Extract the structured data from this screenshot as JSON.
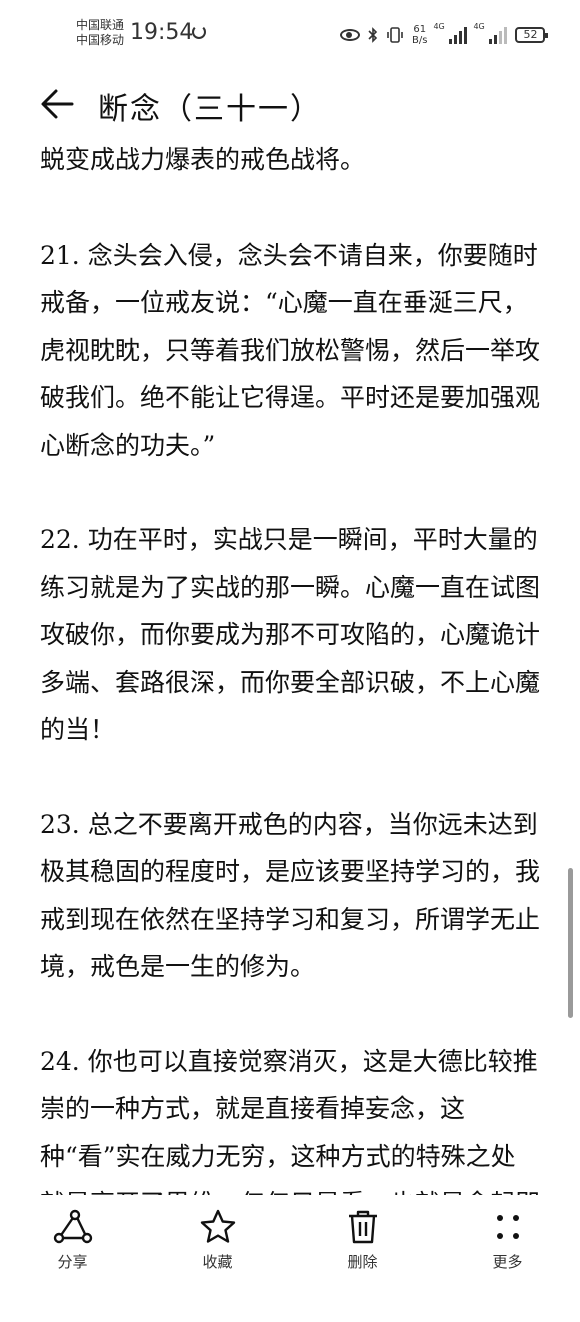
{
  "status_bar": {
    "carrier1": "中国联通",
    "carrier2": "中国移动",
    "time": "19:54",
    "net_speed_value": "61",
    "net_speed_unit": "B/s",
    "network1": "4G",
    "network2": "4G",
    "battery": "52"
  },
  "header": {
    "title": "断念（三十一）"
  },
  "content": {
    "paragraphs": [
      "蜕变成战力爆表的戒色战将。",
      "21. 念头会入侵，念头会不请自来，你要随时戒备，一位戒友说：“心魔一直在垂涎三尺，虎视眈眈，只等着我们放松警惕，然后一举攻破我们。绝不能让它得逞。平时还是要加强观心断念的功夫。”",
      "22. 功在平时，实战只是一瞬间，平时大量的练习就是为了实战的那一瞬。心魔一直在试图攻破你，而你要成为那不可攻陷的，心魔诡计多端、套路很深，而你要全部识破，不上心魔的当！",
      "23. 总之不要离开戒色的内容，当你远未达到极其稳固的程度时，是应该要坚持学习的，我戒到现在依然在坚持学习和复习，所谓学无止境，戒色是一生的修为。",
      "24. 你也可以直接觉察消灭，这是大德比较推崇的一种方式，就是直接看掉妄念，这种“看”实在威力无穷，这种方式的特殊之处就是离开了思维，仅仅只是看，也就是念起即觉，觉之即无。"
    ]
  },
  "toolbar": {
    "share_label": "分享",
    "favorite_label": "收藏",
    "delete_label": "删除",
    "more_label": "更多"
  }
}
